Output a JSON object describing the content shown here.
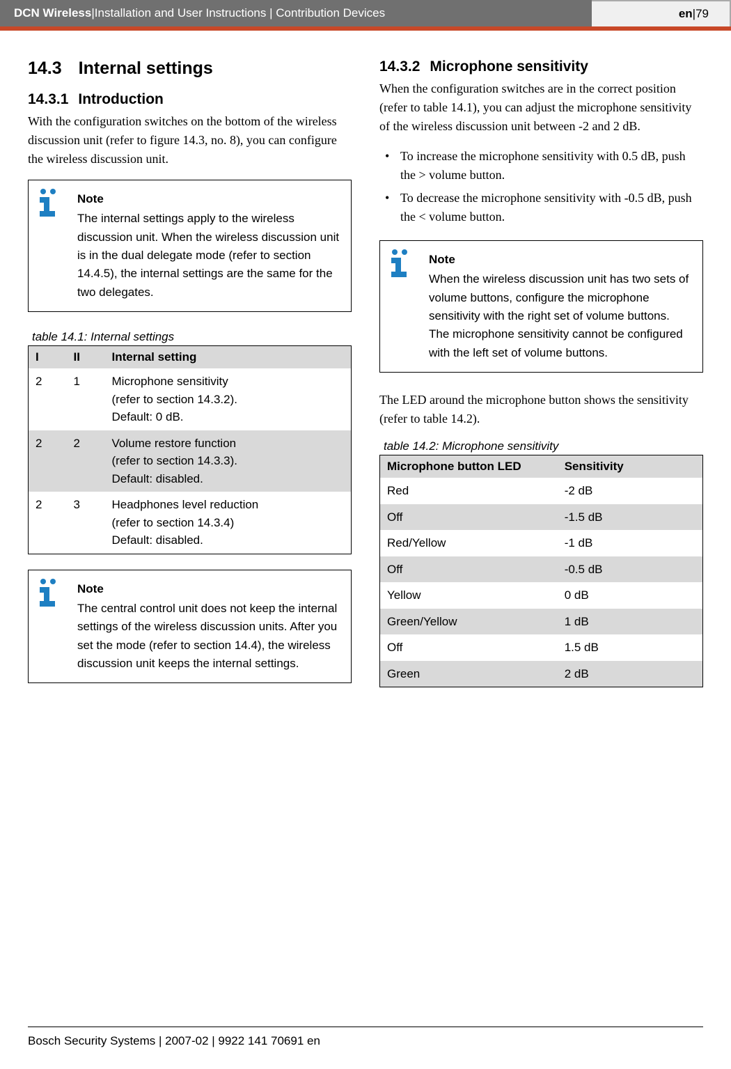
{
  "header": {
    "product": "DCN Wireless",
    "sep": " | ",
    "subtitle": "Installation and User Instructions | Contribution Devices",
    "lang": "en",
    "page": "79"
  },
  "left": {
    "h2_num": "14.3",
    "h2_title": "Internal settings",
    "h3_num": "14.3.1",
    "h3_title": "Introduction",
    "intro": "With the configuration switches on the bottom of the wireless discussion unit (refer to figure 14.3, no. 8), you can configure the wireless discussion unit.",
    "note1_title": "Note",
    "note1_body": "The internal settings apply to the wireless discussion unit. When the wireless discussion unit is in the dual delegate mode (refer to section 14.4.5), the internal settings are the same for the two delegates.",
    "table1_caption": "table 14.1: Internal settings",
    "table1_head": {
      "c1": "I",
      "c2": "II",
      "c3": "Internal setting"
    },
    "table1_rows": [
      {
        "c1": "2",
        "c2": "1",
        "c3": "Microphone sensitivity\n(refer to section 14.3.2).\nDefault: 0 dB."
      },
      {
        "c1": "2",
        "c2": "2",
        "c3": "Volume restore function\n(refer to section 14.3.3).\nDefault: disabled."
      },
      {
        "c1": "2",
        "c2": "3",
        "c3": "Headphones level reduction\n(refer to section 14.3.4)\nDefault: disabled."
      }
    ],
    "note2_title": "Note",
    "note2_body": "The central control unit does not keep the internal settings of the wireless discussion units. After you set the mode (refer to section 14.4), the wireless discussion unit keeps the internal settings."
  },
  "right": {
    "h3_num": "14.3.2",
    "h3_title": "Microphone sensitivity",
    "intro": "When the configuration switches are in the correct position (refer to table 14.1), you can adjust the microphone sensitivity of the wireless discussion unit between -2 and 2 dB.",
    "bullets": [
      "To increase the microphone sensitivity with 0.5 dB, push the > volume button.",
      "To decrease the microphone sensitivity with -0.5 dB, push the < volume button."
    ],
    "note_title": "Note",
    "note_body": "When the wireless discussion unit has two sets of volume buttons, configure the microphone sensitivity with the right set of volume buttons. The microphone sensitivity cannot be configured with the left set of volume buttons.",
    "para2": "The LED around the microphone button shows the sensitivity (refer to table 14.2).",
    "table2_caption": "table 14.2: Microphone sensitivity",
    "table2_head": {
      "c1": "Microphone button LED",
      "c2": "Sensitivity"
    },
    "table2_rows": [
      {
        "c1": "Red",
        "c2": "-2 dB"
      },
      {
        "c1": "Off",
        "c2": "-1.5 dB"
      },
      {
        "c1": "Red/Yellow",
        "c2": "-1 dB"
      },
      {
        "c1": "Off",
        "c2": "-0.5 dB"
      },
      {
        "c1": "Yellow",
        "c2": "0 dB"
      },
      {
        "c1": "Green/Yellow",
        "c2": "1 dB"
      },
      {
        "c1": "Off",
        "c2": "1.5 dB"
      },
      {
        "c1": "Green",
        "c2": "2 dB"
      }
    ]
  },
  "footer": "Bosch Security Systems | 2007-02 | 9922 141 70691 en",
  "chart_data": {
    "type": "table",
    "tables": [
      {
        "title": "table 14.1: Internal settings",
        "columns": [
          "I",
          "II",
          "Internal setting"
        ],
        "rows": [
          [
            "2",
            "1",
            "Microphone sensitivity (refer to section 14.3.2). Default: 0 dB."
          ],
          [
            "2",
            "2",
            "Volume restore function (refer to section 14.3.3). Default: disabled."
          ],
          [
            "2",
            "3",
            "Headphones level reduction (refer to section 14.3.4) Default: disabled."
          ]
        ]
      },
      {
        "title": "table 14.2: Microphone sensitivity",
        "columns": [
          "Microphone button LED",
          "Sensitivity"
        ],
        "rows": [
          [
            "Red",
            "-2 dB"
          ],
          [
            "Off",
            "-1.5 dB"
          ],
          [
            "Red/Yellow",
            "-1 dB"
          ],
          [
            "Off",
            "-0.5 dB"
          ],
          [
            "Yellow",
            "0 dB"
          ],
          [
            "Green/Yellow",
            "1 dB"
          ],
          [
            "Off",
            "1.5 dB"
          ],
          [
            "Green",
            "2 dB"
          ]
        ]
      }
    ]
  }
}
